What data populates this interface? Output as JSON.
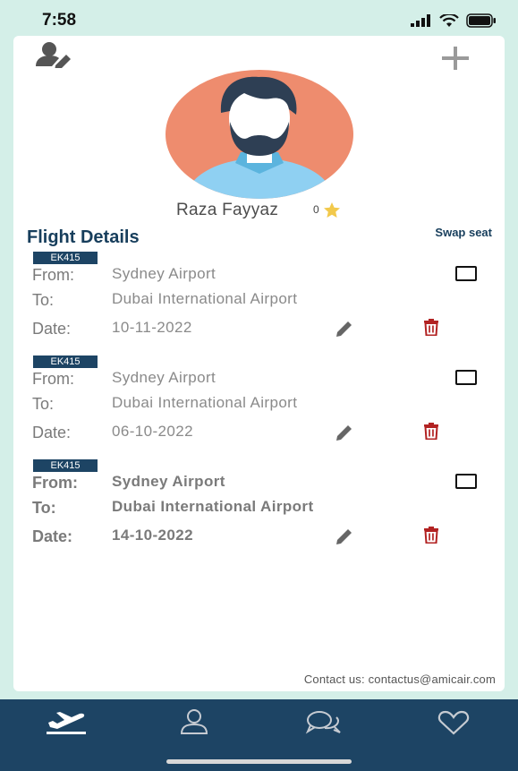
{
  "status": {
    "time": "7:58"
  },
  "profile": {
    "name": "Raza Fayyaz",
    "stars": "0"
  },
  "section": {
    "title": "Flight Details",
    "swap_seat": "Swap seat"
  },
  "labels": {
    "from": "From:",
    "to": "To:",
    "date": "Date:"
  },
  "flights": [
    {
      "code": "EK415",
      "from": "Sydney Airport",
      "to": "Dubai International Airport",
      "date": "10-11-2022",
      "selected": false
    },
    {
      "code": "EK415",
      "from": "Sydney Airport",
      "to": "Dubai International Airport",
      "date": "06-10-2022",
      "selected": false
    },
    {
      "code": "EK415",
      "from": "Sydney Airport",
      "to": "Dubai International Airport",
      "date": "14-10-2022",
      "selected": false
    }
  ],
  "footer": {
    "contact": "Contact us: contactus@amicair.com"
  },
  "nav": [
    {
      "icon": "flight-takeoff-icon"
    },
    {
      "icon": "person-icon"
    },
    {
      "icon": "chat-icon"
    },
    {
      "icon": "heart-icon"
    }
  ],
  "colors": {
    "primary": "#1d4464",
    "background": "#d4efe8",
    "delete": "#b22222",
    "star": "#f2c94c",
    "avatar_bg": "#ee8c6e"
  }
}
